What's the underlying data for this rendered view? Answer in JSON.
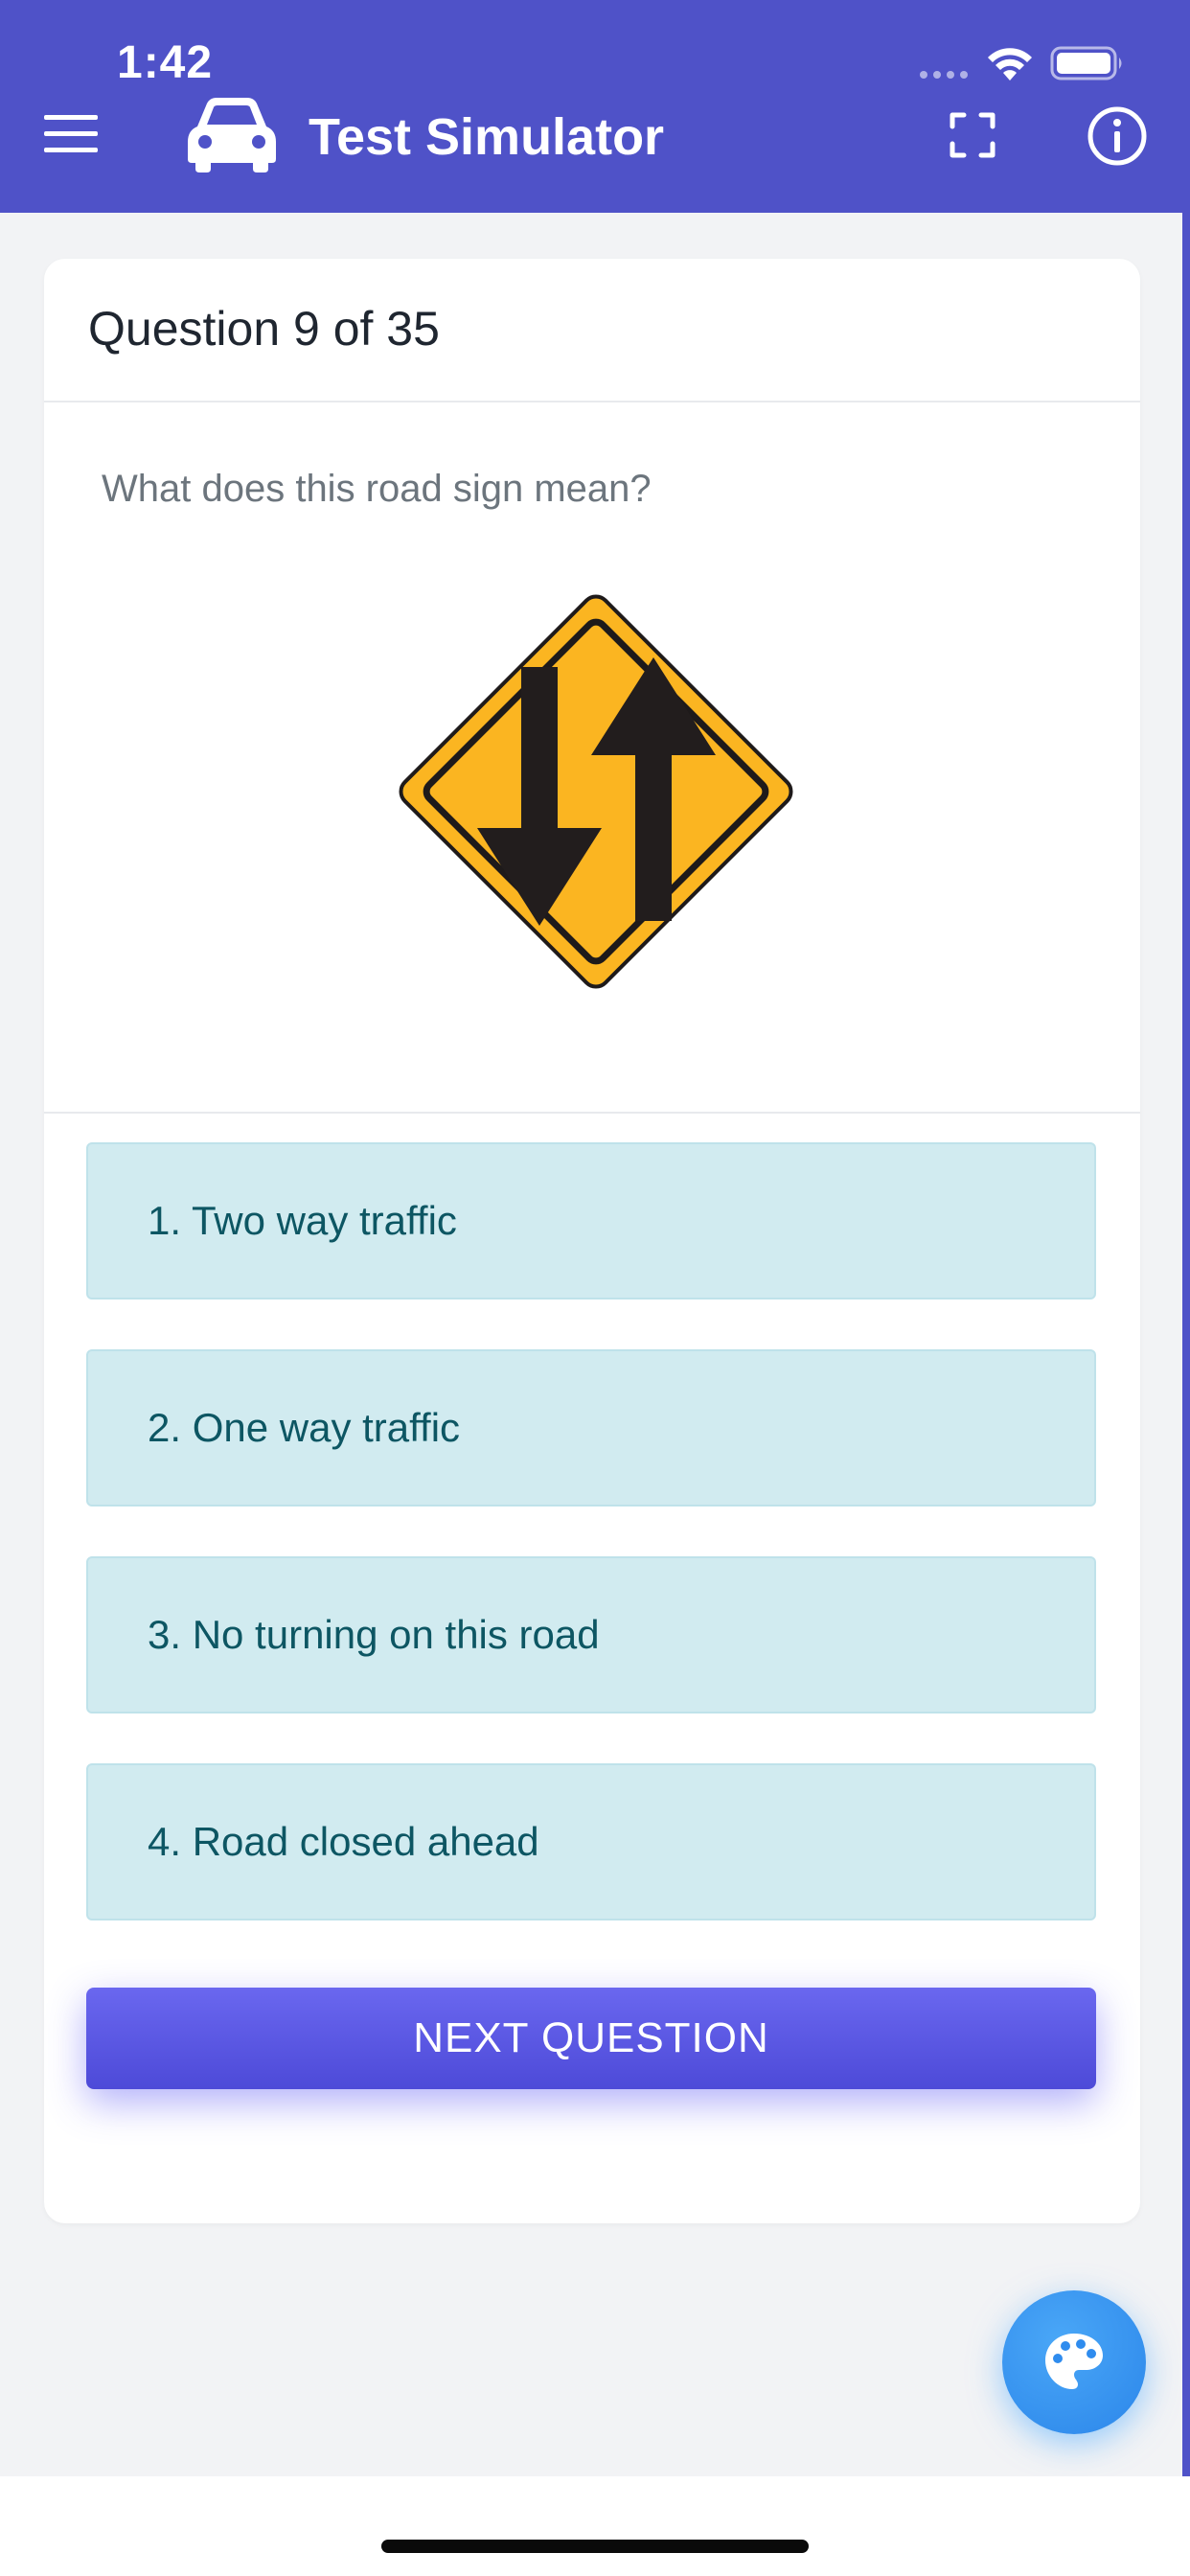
{
  "status_bar": {
    "time": "1:42"
  },
  "header": {
    "title": "Test Simulator",
    "menu_icon": "hamburger-menu-icon",
    "logo_icon": "car-icon",
    "fullscreen_icon": "fullscreen-icon",
    "info_icon": "info-icon",
    "background_color": "#4f52c8"
  },
  "card": {
    "title": "Question 9 of 35",
    "question": "What does this road sign mean?",
    "sign_icon": "two-way-traffic-sign-icon",
    "options": [
      {
        "label": "1. Two way traffic"
      },
      {
        "label": "2. One way traffic"
      },
      {
        "label": "3. No turning on this road"
      },
      {
        "label": "4. Road closed ahead"
      }
    ],
    "next_label": "NEXT QUESTION"
  },
  "fab": {
    "icon": "palette-icon"
  },
  "colors": {
    "accent": "#5a57e6",
    "option_bg": "#d1ebf0",
    "option_text": "#0d5663",
    "sign_yellow": "#fbb521",
    "fab": "#2b86ea"
  }
}
